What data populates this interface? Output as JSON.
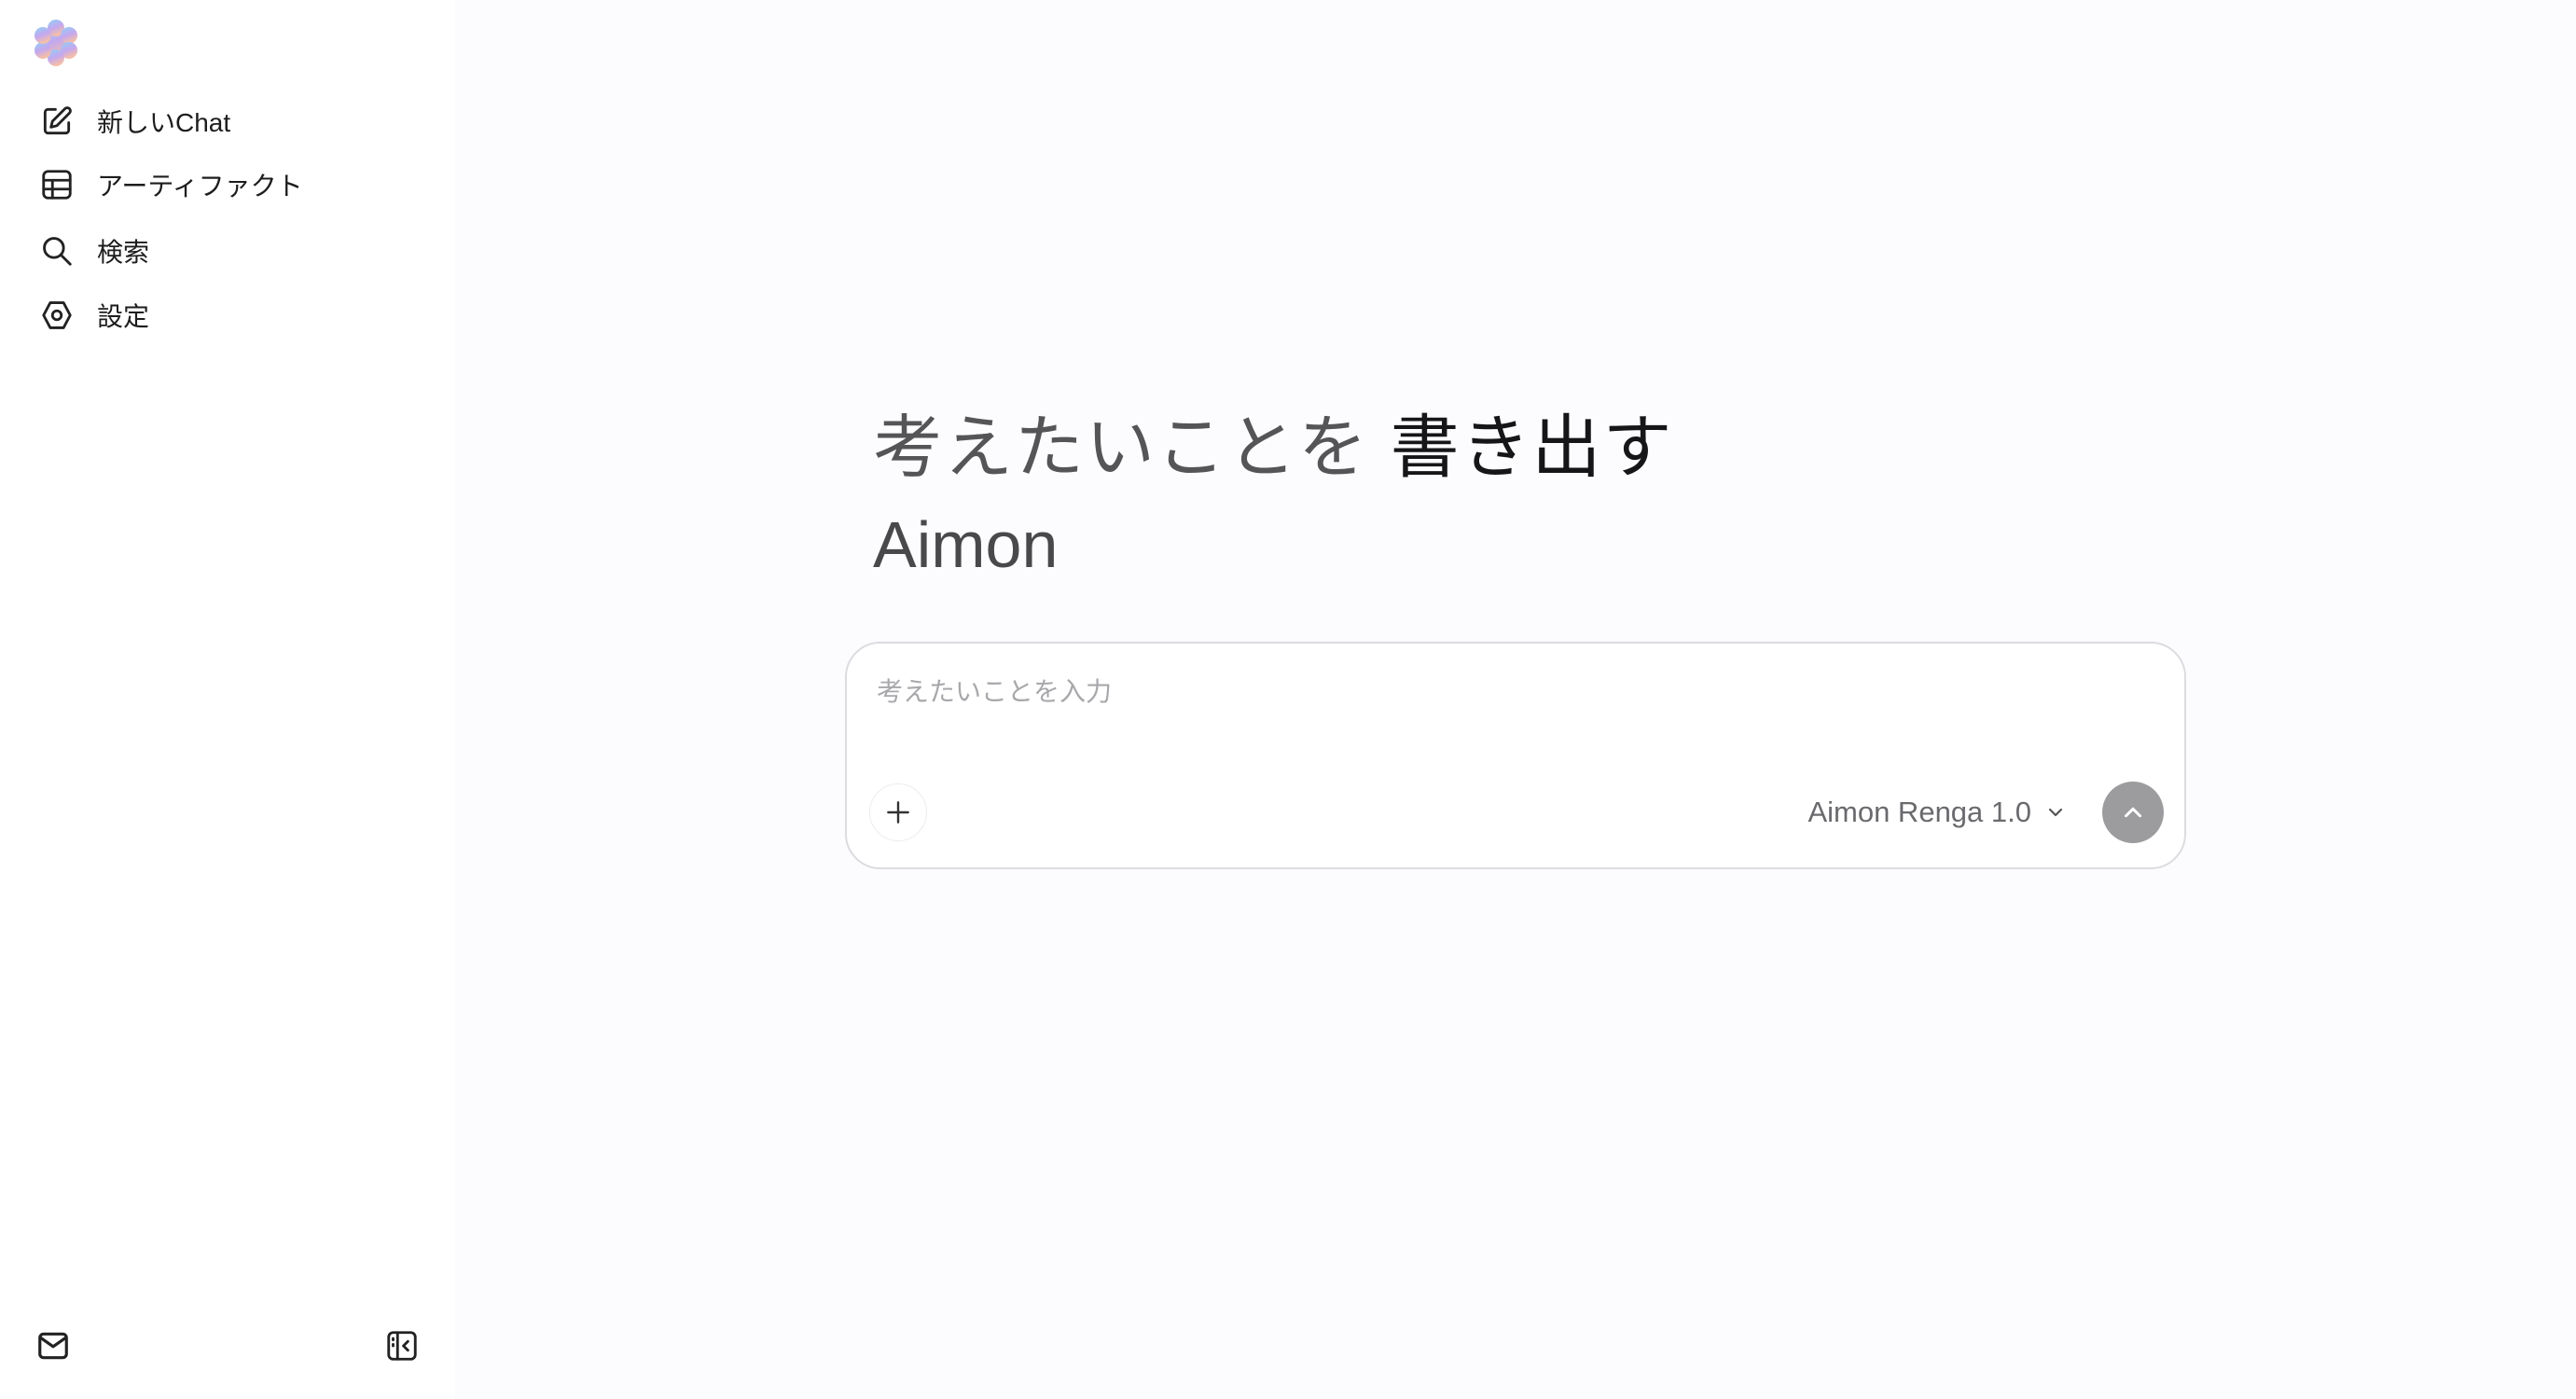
{
  "sidebar": {
    "logo_icon": "flower-gradient-logo",
    "items": [
      {
        "label": "新しいChat",
        "icon": "edit-icon"
      },
      {
        "label": "アーティファクト",
        "icon": "table-icon"
      },
      {
        "label": "検索",
        "icon": "search-icon"
      },
      {
        "label": "設定",
        "icon": "settings-icon"
      }
    ],
    "bottom": [
      {
        "icon": "mail-icon"
      },
      {
        "icon": "sidebar-toggle-icon"
      }
    ]
  },
  "hero": {
    "line1_muted": "考えたいことを ",
    "line1_strong": "書き出す",
    "line2": "Aimon"
  },
  "composer": {
    "placeholder": "考えたいことを入力",
    "value": "",
    "model": "Aimon Renga 1.0",
    "add_icon": "plus-icon",
    "model_icon": "chevron-down-icon",
    "send_icon": "chevron-up-icon"
  },
  "colors": {
    "background": "#fcfcfe",
    "send_button": "#9c9c9f",
    "border": "#dcdce0"
  }
}
